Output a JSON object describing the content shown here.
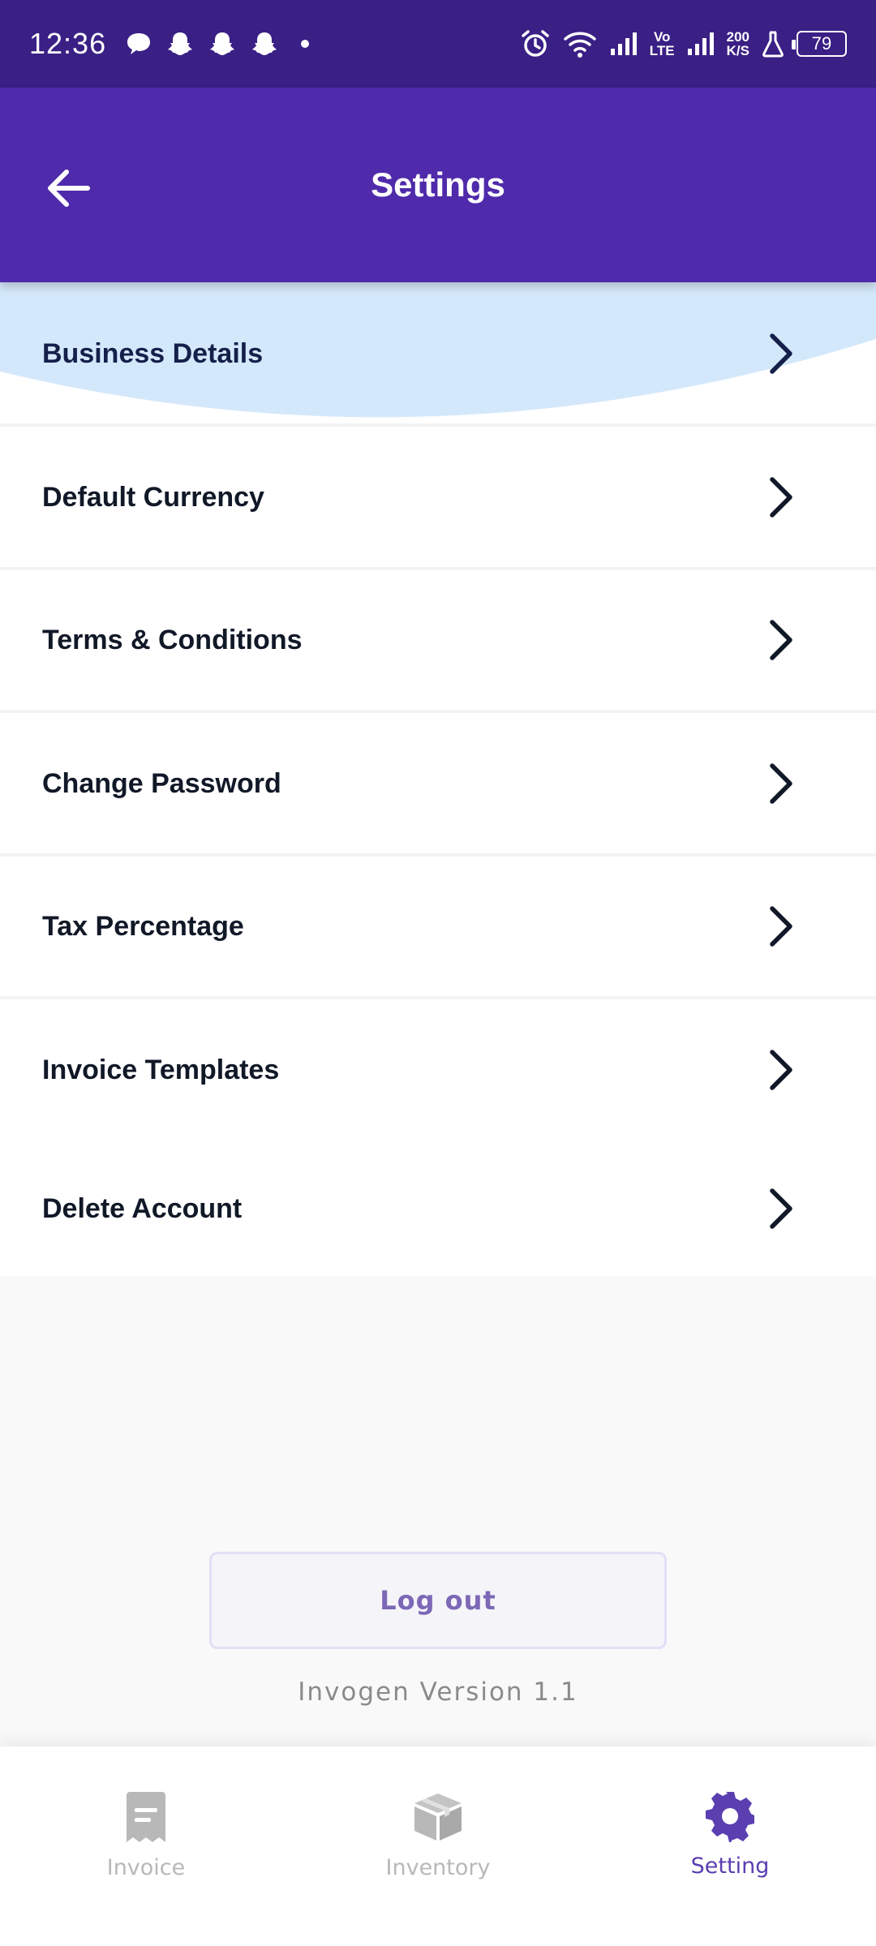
{
  "status_bar": {
    "time": "12:36",
    "network_speed_top": "200",
    "network_speed_bottom": "K/S",
    "volte_top": "Vo",
    "volte_bottom": "LTE",
    "battery": "79"
  },
  "app_bar": {
    "title": "Settings"
  },
  "settings": {
    "items": [
      {
        "label": "Business Details"
      },
      {
        "label": "Default Currency"
      },
      {
        "label": "Terms & Conditions"
      },
      {
        "label": "Change Password"
      },
      {
        "label": "Tax Percentage"
      },
      {
        "label": "Invoice Templates"
      },
      {
        "label": "Delete Account"
      }
    ]
  },
  "logout": {
    "label": "Log out"
  },
  "version": "Invogen Version 1.1",
  "bottom_nav": {
    "items": [
      {
        "label": "Invoice",
        "icon": "receipt-icon"
      },
      {
        "label": "Inventory",
        "icon": "box-icon"
      },
      {
        "label": "Setting",
        "icon": "gear-icon"
      }
    ],
    "active_index": 2
  },
  "colors": {
    "status_bar": "#3a1f85",
    "app_bar": "#4f2bab",
    "accent": "#5b3fb0",
    "highlight_wave": "#d4e8fb",
    "inactive_nav": "#b8b8b8"
  }
}
